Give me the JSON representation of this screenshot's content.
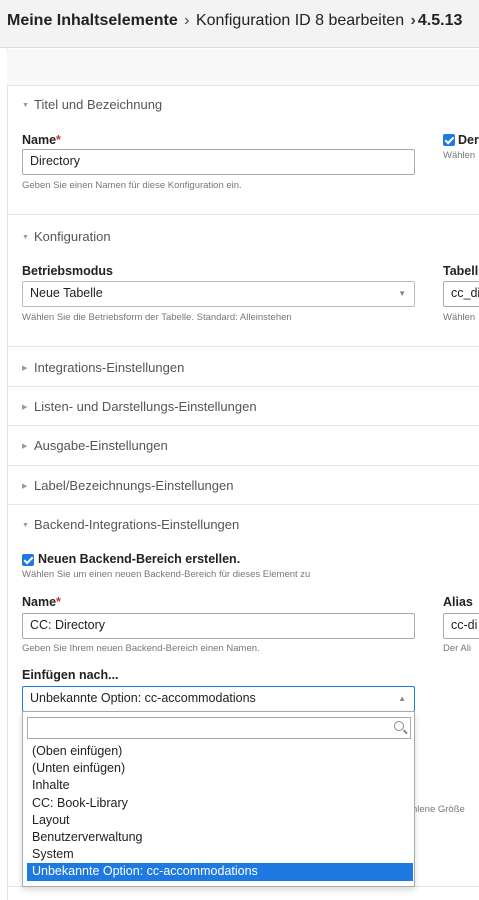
{
  "breadcrumb": {
    "root": "Meine Inhaltselemente",
    "sep1": "›",
    "current": "Konfiguration ID 8 bearbeiten",
    "sep2": "›",
    "version": "4.5.13"
  },
  "sections": {
    "title": "Titel und Bezeichnung",
    "config": "Konfiguration",
    "integration": "Integrations-Einstellungen",
    "list": "Listen- und Darstellungs-Einstellungen",
    "output": "Ausgabe-Einstellungen",
    "label": "Label/Bezeichnungs-Einstellungen",
    "backend": "Backend-Integrations-Einstellungen"
  },
  "title_section": {
    "name_label": "Name",
    "required": "*",
    "name_value": "Directory",
    "name_help": "Geben Sie einen Namen für diese Konfiguration ein.",
    "right_label_fragment": "Der",
    "right_help_fragment": "Wählen"
  },
  "config_section": {
    "mode_label": "Betriebsmodus",
    "mode_value": "Neue Tabelle",
    "mode_help": "Wählen Sie die Betriebsform der Tabelle. Standard: Alleinstehen",
    "table_label_fragment": "Tabell",
    "table_value_fragment": "cc_di",
    "table_help_fragment": "Wählen"
  },
  "backend_section": {
    "create_label": "Neuen Backend-Bereich erstellen.",
    "create_help": "Wählen Sie um einen neuen Backend-Bereich für dieses Element zu",
    "name_label": "Name",
    "required": "*",
    "name_value": "CC: Directory",
    "name_help": "Geben Sie Ihrem neuen Backend-Bereich einen Namen.",
    "alias_label": "Alias",
    "alias_value_fragment": "cc-di",
    "alias_help_fragment": "Der Ali",
    "insert_label": "Einfügen nach...",
    "insert_value": "Unbekannte Option: cc-accommodations",
    "size_help_fragment": "hlene Größe"
  },
  "dropdown": {
    "search_value": "",
    "options": [
      "(Oben einfügen)",
      "(Unten einfügen)",
      "Inhalte",
      "CC: Book-Library",
      "Layout",
      "Benutzerverwaltung",
      "System",
      "Unbekannte Option: cc-accommodations"
    ],
    "selected_index": 7
  },
  "colors": {
    "accent": "#1e7ae0",
    "required": "#cc3333"
  }
}
